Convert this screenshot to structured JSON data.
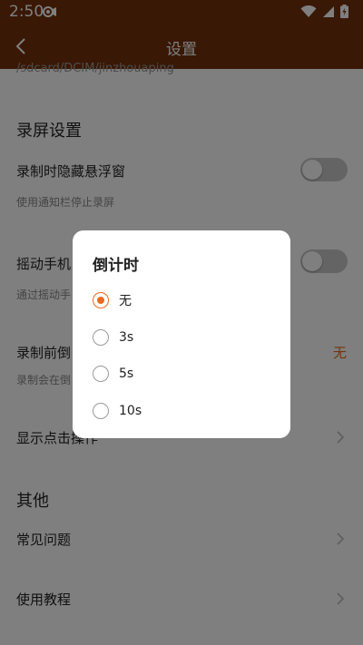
{
  "status_bar": {
    "time": "2:50"
  },
  "app_bar": {
    "title": "设置"
  },
  "storage_path": "/sdcard/DCIM/jinzhouaping",
  "screen_record_section": {
    "title": "录屏设置",
    "items": [
      {
        "title": "录制时隐藏悬浮窗",
        "subtitle": "使用通知栏停止录屏",
        "switch_on": false
      },
      {
        "title": "摇动手机",
        "subtitle": "通过摇动手",
        "switch_on": false
      },
      {
        "title": "录制前倒",
        "subtitle": "录制会在倒",
        "value": "无"
      },
      {
        "title": "显示点击操作"
      }
    ]
  },
  "other_section": {
    "title": "其他",
    "items": [
      {
        "title": "常见问题"
      },
      {
        "title": "使用教程"
      }
    ]
  },
  "dialog": {
    "title": "倒计时",
    "options": [
      {
        "label": "无",
        "selected": true
      },
      {
        "label": "3s",
        "selected": false
      },
      {
        "label": "5s",
        "selected": false
      },
      {
        "label": "10s",
        "selected": false
      }
    ]
  },
  "colors": {
    "header": "#72300a",
    "accent": "#e96a1c"
  }
}
